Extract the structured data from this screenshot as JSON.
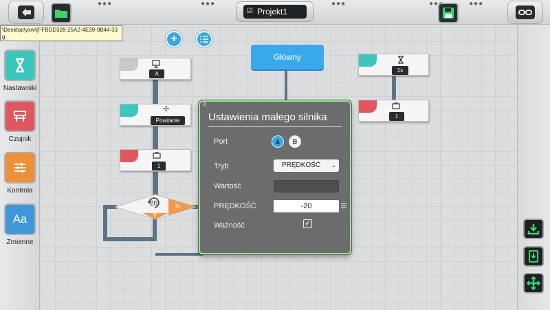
{
  "header": {
    "project_title": "Projekt1",
    "tooltip_text": "\\Desktop\\yxw\\{FFBDD328-25A2-4E39-9B44-33",
    "tooltip_text_2": "g"
  },
  "sidebar": {
    "items": [
      {
        "label": "Nastawniki",
        "icon": "hourglass-icon",
        "color": "#3dc6bb"
      },
      {
        "label": "Czujnik",
        "icon": "sensor-icon",
        "color": "#e2575f"
      },
      {
        "label": "Kontrola",
        "icon": "sliders-icon",
        "color": "#ef8f3a"
      },
      {
        "label": "Zmienne",
        "icon": "text-aa-icon",
        "color": "#3f97d9"
      }
    ]
  },
  "canvas": {
    "main_label": "Główny",
    "blocks": {
      "display_val": "A",
      "greeting_val": "Powitanie",
      "light_val": "1",
      "loop_count": "20",
      "loop_no": "N",
      "loop_yes": "Y",
      "timer_val": "1s",
      "right_light_val": "1"
    }
  },
  "panel": {
    "title": "Ustawienia małego silnika",
    "port_label": "Port",
    "port_a": "A",
    "port_b": "B",
    "mode_label": "Tryb",
    "mode_value": "PRĘDKOŚĆ",
    "value_label": "Wartość",
    "speed_label": "PRĘDKOŚĆ",
    "speed_value": "-20",
    "validity_label": "Ważność",
    "validity_checked": "✓"
  },
  "colors": {
    "accent_blue": "#3aa9ec",
    "green_icon": "#3bd46b",
    "panel_bg": "#6b6c6d",
    "connector": "#5d7485"
  }
}
